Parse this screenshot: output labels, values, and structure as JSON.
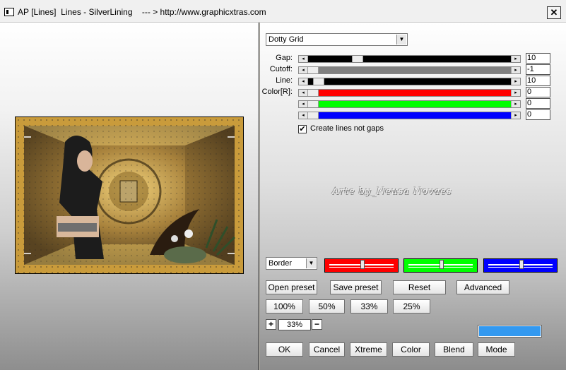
{
  "window": {
    "title": "AP [Lines]  Lines - SilverLining    --- > http://www.graphicxtras.com",
    "close_glyph": "✕",
    "app_icon": "filter-app-icon"
  },
  "pattern": {
    "selected": "Dotty Grid"
  },
  "sliders": [
    {
      "label": "Gap:",
      "value": "10",
      "fill": "#000000",
      "level": 0.23
    },
    {
      "label": "Cutoff:",
      "value": "-1",
      "fill": "#808080",
      "level": 0.0
    },
    {
      "label": "Line:",
      "value": "10",
      "fill": "#000000",
      "level": 0.03
    },
    {
      "label": "Color[R]:",
      "value": "0",
      "fill": "#ff0000",
      "level": 0.0
    },
    {
      "label": "",
      "value": "0",
      "fill": "#00ff00",
      "level": 0.0
    },
    {
      "label": "",
      "value": "0",
      "fill": "#0000ff",
      "level": 0.0
    }
  ],
  "create_lines": {
    "checked": true,
    "mark": "✔",
    "label": "Create lines not gaps"
  },
  "watermark": "Arte by_Neusa Novaes",
  "border": {
    "selected": "Border"
  },
  "color_boxes": [
    {
      "color": "#ff0000",
      "level": 0.5
    },
    {
      "color": "#00ff00",
      "level": 0.5
    },
    {
      "color": "#0000ff",
      "level": 0.5
    }
  ],
  "buttons": {
    "open_preset": "Open preset",
    "save_preset": "Save preset",
    "reset": "Reset",
    "advanced": "Advanced",
    "z100": "100%",
    "z50": "50%",
    "z33": "33%",
    "z25": "25%",
    "ok": "OK",
    "cancel": "Cancel",
    "xtreme": "Xtreme",
    "color": "Color",
    "blend": "Blend",
    "mode": "Mode"
  },
  "zoom": {
    "plus": "+",
    "minus": "−",
    "value": "33%"
  },
  "swatch_color": "#3399f0"
}
